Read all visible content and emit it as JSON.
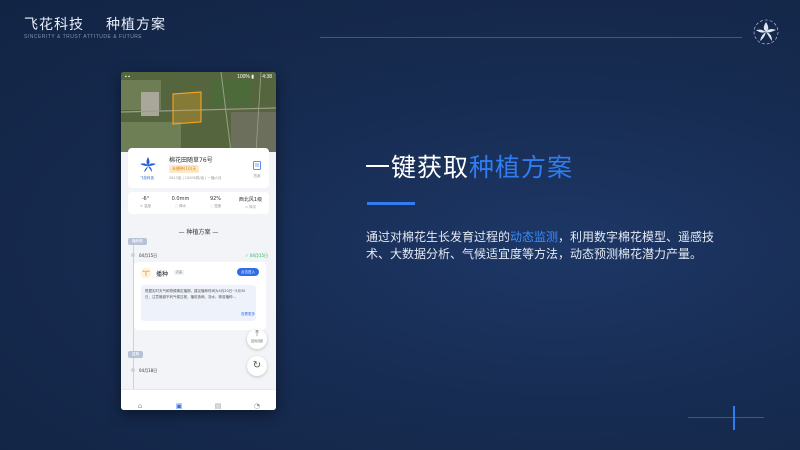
{
  "header": {
    "company": "飞花科技",
    "section": "种植方案",
    "slogan": "SINCERITY & TRUST ATTITUDE & FUTURE"
  },
  "phone": {
    "status_time": "4:38",
    "status_signal": "100% ▮",
    "field": {
      "logo_text": "飞花科技",
      "name": "棉花田随草76号",
      "badge": "未播种(10)天",
      "meta": "2813亩 | 10000株/亩 | 一播六月",
      "file_label": "档案"
    },
    "weather": [
      {
        "value": "-6°",
        "label": "温度"
      },
      {
        "value": "0.0mm",
        "label": "降水"
      },
      {
        "value": "92%",
        "label": "湿度"
      },
      {
        "value": "西北风1级",
        "label": "风向"
      }
    ],
    "plan_title": "种植方案",
    "timeline": {
      "tag1": "播种期",
      "date1": "04月15日",
      "date1_right": "04月15日",
      "tag2": "苗期",
      "date2": "04月18日"
    },
    "stage": {
      "name": "播种",
      "tag": "农事",
      "button": "点击进入",
      "desc": "根据实时天气和物候确定播期，建议播种时间为4月20日~5月30日，注意躲避不利气候过程，播前造墒、浇水、精准播种…",
      "more": "查看更多"
    },
    "fab_top_label": "回到顶部",
    "tabs": [
      "首页",
      "方案",
      "巡查",
      "我的"
    ]
  },
  "headline": {
    "prefix": "一键获取",
    "highlight": "种植方案"
  },
  "description": {
    "before": "通过对棉花生长发育过程的",
    "highlight": "动态监测",
    "after": "，利用数字棉花模型、遥感技术、大数据分析、气候适宜度等方法，动态预测棉花潜力产量。"
  },
  "colors": {
    "background": "#172c52",
    "accent": "#2f7df0",
    "primary_button": "#2f6ee8"
  },
  "icons": [
    "flower-logo-icon",
    "file-icon",
    "thermometer-icon",
    "rain-icon",
    "humidity-icon",
    "wind-icon",
    "seed-icon",
    "check-icon",
    "top-arrow-icon",
    "refresh-icon",
    "home-icon",
    "plan-icon",
    "patrol-icon",
    "user-icon"
  ]
}
